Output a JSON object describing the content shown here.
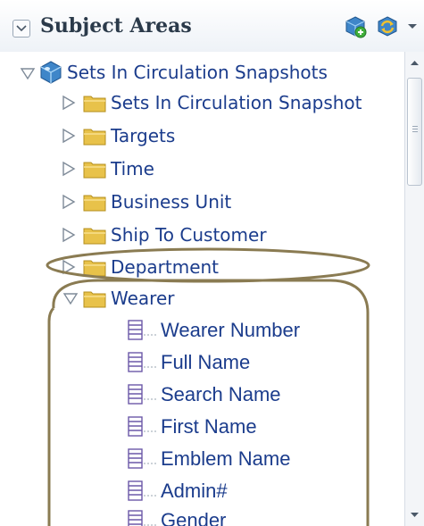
{
  "panel": {
    "title": "Subject Areas",
    "header_icons": [
      "add-subject-area-icon",
      "refresh-icon"
    ]
  },
  "tree": {
    "root": {
      "label": "Sets In Circulation Snapshots",
      "icon": "cube-icon",
      "expanded": true
    },
    "folders": [
      {
        "label": "Sets In Circulation Snapshot",
        "expanded": false
      },
      {
        "label": "Targets",
        "expanded": false
      },
      {
        "label": "Time",
        "expanded": false
      },
      {
        "label": "Business Unit",
        "expanded": false
      },
      {
        "label": "Ship To Customer",
        "expanded": false
      },
      {
        "label": "Department",
        "expanded": false
      },
      {
        "label": "Wearer",
        "expanded": true
      }
    ],
    "wearer_columns": [
      "Wearer Number",
      "Full Name",
      "Search Name",
      "First Name",
      "Emblem Name",
      "Admin#",
      "Gender"
    ]
  },
  "colors": {
    "text": "#1b3c8c",
    "folder": "#e8c24a",
    "annotation": "#8a7b52"
  }
}
